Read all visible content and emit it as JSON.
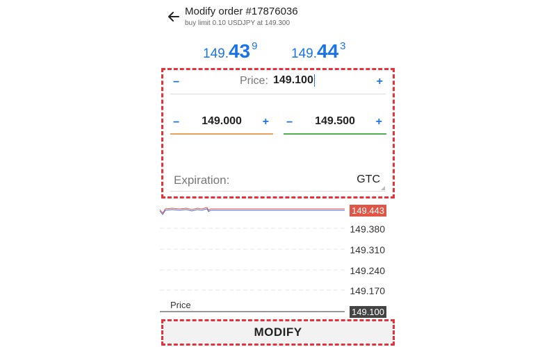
{
  "header": {
    "title": "Modify order #17876036",
    "subtitle": "buy limit 0.10 USDJPY at 149.300"
  },
  "quotes": {
    "bid": {
      "small": "149.",
      "big": "43",
      "sup": "9"
    },
    "ask": {
      "small": "149.",
      "big": "44",
      "sup": "3"
    }
  },
  "form": {
    "price_label": "Price:",
    "price_value": "149.100",
    "stop_loss": "149.000",
    "take_profit": "149.500",
    "expiration_label": "Expiration:",
    "expiration_value": "GTC",
    "minus": "−",
    "plus": "+"
  },
  "chart": {
    "current_price_tag": "149.443",
    "ticks": [
      "149.380",
      "149.310",
      "149.240",
      "149.170"
    ],
    "order_price_tag": "149.100",
    "line_label": "Price",
    "colors": {
      "current": "#e05545",
      "order": "#444444",
      "bid_line": "#4a6fd8",
      "ask_line": "#e05545"
    }
  },
  "modify_label": "MODIFY"
}
